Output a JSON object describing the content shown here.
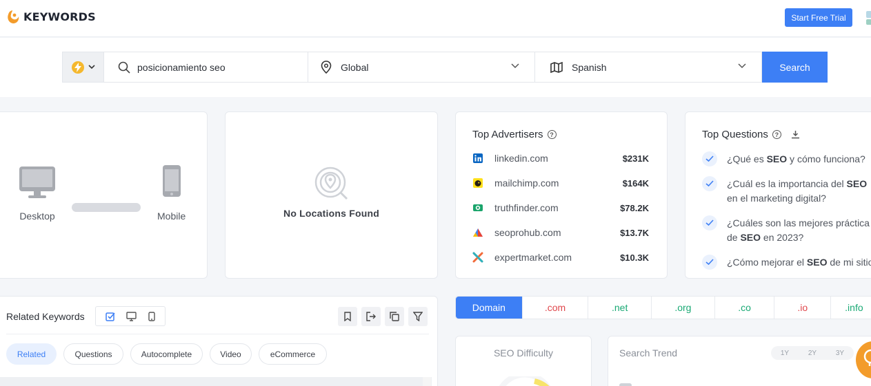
{
  "brand": {
    "name": "KEYWORDS",
    "color": "#f39c2b"
  },
  "header": {
    "trial_label": "Start Free Trial",
    "accent": "#3d7ff5"
  },
  "search": {
    "type_icon": "bolt-icon",
    "query": "posicionamiento seo",
    "location": "Global",
    "language": "Spanish",
    "button_label": "Search"
  },
  "devices": {
    "desktop_label": "Desktop",
    "mobile_label": "Mobile"
  },
  "locations": {
    "empty_label": "No Locations Found"
  },
  "advertisers": {
    "title": "Top Advertisers",
    "items": [
      {
        "domain": "linkedin.com",
        "amount": "$231K",
        "icon": "linkedin-icon"
      },
      {
        "domain": "mailchimp.com",
        "amount": "$164K",
        "icon": "mailchimp-icon"
      },
      {
        "domain": "truthfinder.com",
        "amount": "$78.2K",
        "icon": "truthfinder-icon"
      },
      {
        "domain": "seoprohub.com",
        "amount": "$13.7K",
        "icon": "seoprohub-icon"
      },
      {
        "domain": "expertmarket.com",
        "amount": "$10.3K",
        "icon": "expertmarket-icon"
      }
    ]
  },
  "questions": {
    "title": "Top Questions",
    "items": [
      {
        "line1_a": "¿Qué es ",
        "line1_b": "SEO",
        "line1_c": " y cómo funciona?",
        "line2_a": "",
        "line2_b": "",
        "line2_c": ""
      },
      {
        "line1_a": "¿Cuál es la importancia del ",
        "line1_b": "SEO",
        "line1_c": "",
        "line2_a": "en el marketing digital?",
        "line2_b": "",
        "line2_c": ""
      },
      {
        "line1_a": "¿Cuáles son las mejores práctica",
        "line1_b": "",
        "line1_c": "",
        "line2_a": "de ",
        "line2_b": "SEO",
        "line2_c": " en 2023?"
      },
      {
        "line1_a": "¿Cómo mejorar el ",
        "line1_b": "SEO",
        "line1_c": " de mi sitio",
        "line2_a": "",
        "line2_b": "",
        "line2_c": ""
      }
    ]
  },
  "related": {
    "title": "Related Keywords",
    "chips": [
      "Related",
      "Questions",
      "Autocomplete",
      "Video",
      "eCommerce"
    ],
    "active_chip": "Related"
  },
  "tlds": {
    "items": [
      "Domain",
      ".com",
      ".net",
      ".org",
      ".co",
      ".io",
      ".info"
    ],
    "active": "Domain",
    "colors": {
      ".com": "#e0474c",
      ".net": "#19a974",
      ".org": "#19a974",
      ".co": "#19a974",
      ".io": "#e0474c",
      ".info": "#19a974"
    }
  },
  "seo_difficulty": {
    "title": "SEO Difficulty"
  },
  "search_trend": {
    "title": "Search Trend",
    "ranges": [
      "1Y",
      "2Y",
      "3Y"
    ]
  }
}
